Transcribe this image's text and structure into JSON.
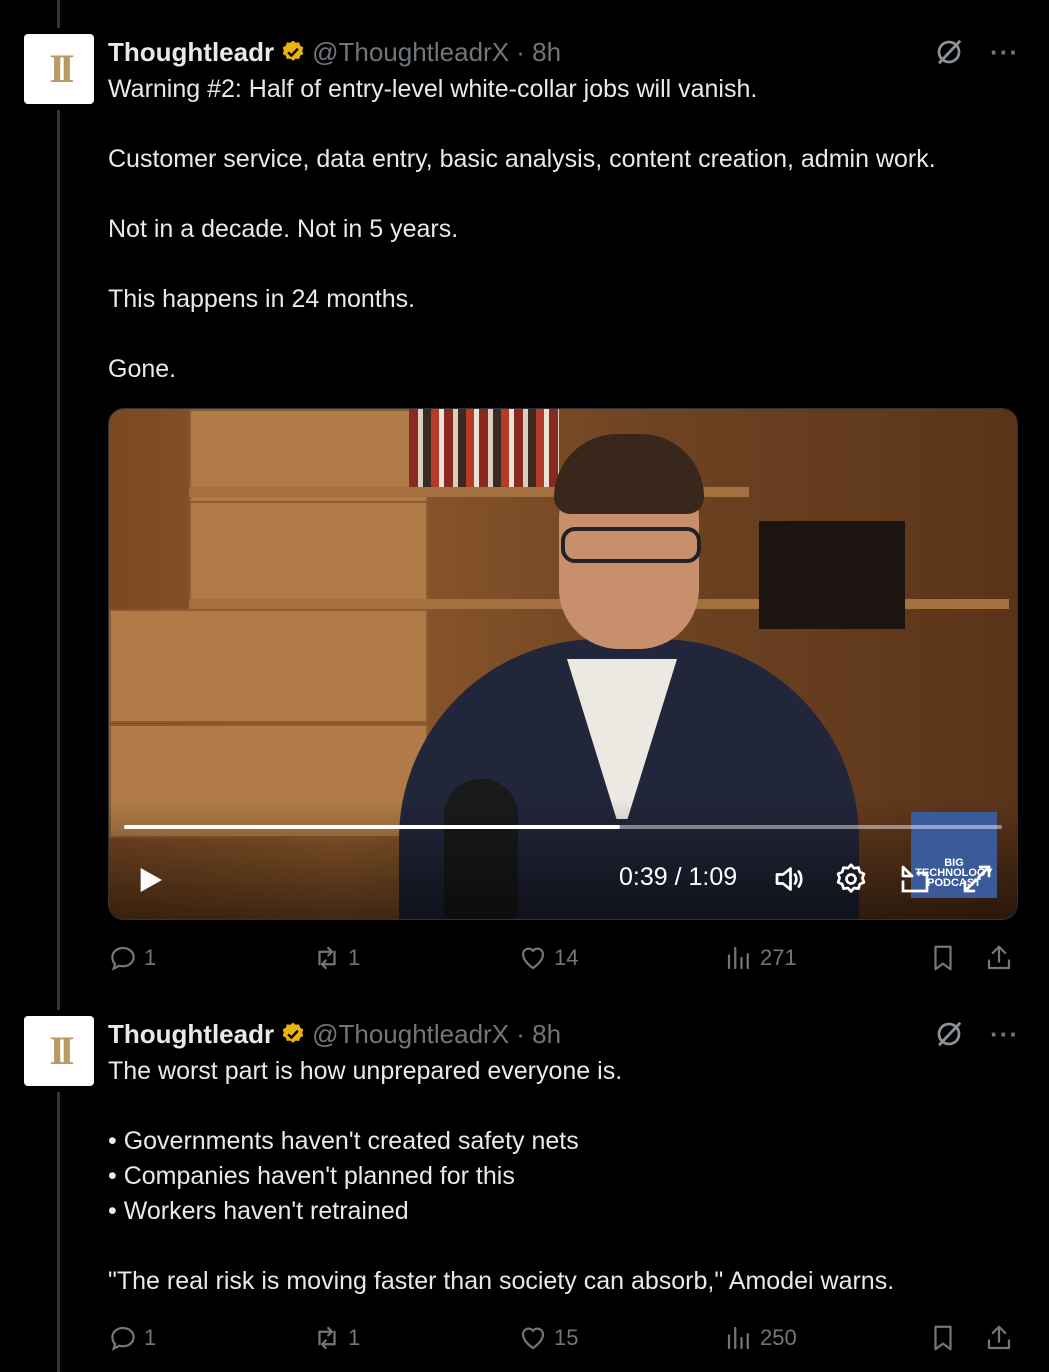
{
  "tweets": [
    {
      "author_name": "Thoughtleadr",
      "handle": "@ThoughtleadrX",
      "time": "8h",
      "meta": "@ThoughtleadrX · 8h",
      "lines": [
        "Warning #2: Half of entry-level white-collar jobs will vanish.",
        "Customer service, data entry, basic analysis, content creation, admin work.",
        "Not in a decade. Not in 5 years.",
        "This happens in 24 months.",
        "Gone."
      ],
      "video": {
        "current_time": "0:39",
        "duration": "1:09",
        "time_display": "0:39 / 1:09",
        "progress": 0.565,
        "watermark_text": "BIG TECHNOLOGY PODCAST"
      },
      "stats": {
        "replies": "1",
        "reposts": "1",
        "likes": "14",
        "views": "271"
      }
    },
    {
      "author_name": "Thoughtleadr",
      "handle": "@ThoughtleadrX",
      "time": "8h",
      "meta": "@ThoughtleadrX · 8h",
      "lines": [
        "The worst part is how unprepared everyone is.",
        "• Governments haven't created safety nets",
        "• Companies haven't planned for this",
        "• Workers haven't retrained",
        "\"The real risk is moving faster than society can absorb,\" Amodei warns."
      ],
      "stats": {
        "replies": "1",
        "reposts": "1",
        "likes": "15",
        "views": "250"
      }
    }
  ],
  "icons": {
    "verified": "verified-badge-icon",
    "grok": "grok-icon",
    "more": "more-icon",
    "reply": "reply-icon",
    "repost": "repost-icon",
    "like": "heart-icon",
    "views": "views-icon",
    "bookmark": "bookmark-icon",
    "share": "share-icon"
  },
  "colors": {
    "background": "#000000",
    "text": "#e7e9ea",
    "muted": "#71767b",
    "verified": "#e8b30f"
  }
}
